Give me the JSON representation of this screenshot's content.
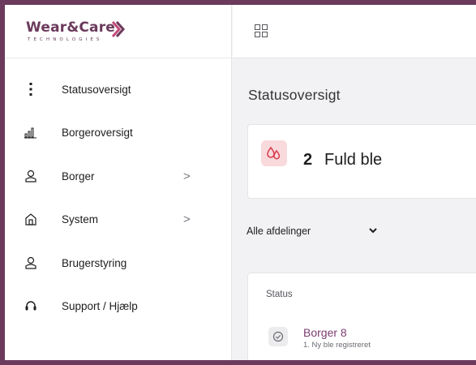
{
  "brand": {
    "name": "Wear&Care",
    "tagline": "TECHNOLOGIES",
    "accent": "#6b3a5c"
  },
  "sidebar": {
    "items": [
      {
        "label": "Statusoversigt",
        "icon": "vertical-dots-icon",
        "has_submenu": false
      },
      {
        "label": "Borgeroversigt",
        "icon": "bar-chart-icon",
        "has_submenu": false
      },
      {
        "label": "Borger",
        "icon": "person-icon",
        "has_submenu": true,
        "chevron": ">"
      },
      {
        "label": "System",
        "icon": "home-icon",
        "has_submenu": true,
        "chevron": ">"
      },
      {
        "label": "Brugerstyring",
        "icon": "user-admin-icon",
        "has_submenu": false
      },
      {
        "label": "Support / Hjælp",
        "icon": "headset-icon",
        "has_submenu": false
      }
    ]
  },
  "topbar": {
    "apps_icon": "grid-icon"
  },
  "main": {
    "title": "Statusoversigt",
    "status_card": {
      "count": "2",
      "label": "Fuld ble",
      "icon": "droplets-icon",
      "badge_color": "#f8d9dc",
      "icon_color": "#d9394a"
    },
    "department_filter": {
      "value": "Alle afdelinger",
      "icon": "chevron-down-icon"
    },
    "list": {
      "header": "Status",
      "rows": [
        {
          "name": "Borger 8",
          "detail": "1. Ny ble registreret",
          "icon": "check-circle-icon"
        }
      ]
    }
  }
}
